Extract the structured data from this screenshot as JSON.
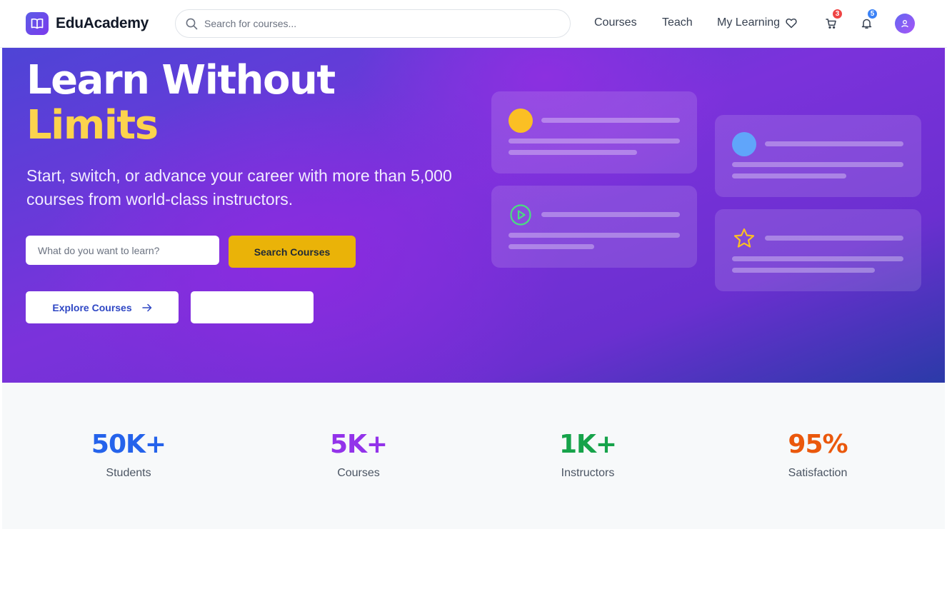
{
  "brand": {
    "name": "EduAcademy",
    "logo_icon": "book-open-icon"
  },
  "nav": {
    "search_placeholder": "Search for courses...",
    "links": {
      "courses": "Courses",
      "teach": "Teach",
      "my_learning": "My Learning"
    },
    "cart_count": "3",
    "notification_count": "5",
    "badge_colors": {
      "cart": "#ef4444",
      "notifications": "#3b82f6"
    }
  },
  "hero": {
    "title_line1": "Learn Without",
    "title_line2": "Limits",
    "subtitle": "Start, switch, or advance your career with more than 5,000 courses from world-class instructors.",
    "search_placeholder": "What do you want to learn?",
    "search_button": "Search Courses",
    "explore_button": "Explore Courses",
    "secondary_button": "",
    "colors": {
      "accent_yellow": "#fcd34d",
      "button_yellow": "#eab308",
      "gradient_start": "#4e44d6",
      "gradient_mid": "#7b32db",
      "gradient_end": "#2b3aa8"
    }
  },
  "illustration_cards": [
    {
      "icon": "yellow-circle",
      "color": "#fbbf24"
    },
    {
      "icon": "blue-circle",
      "color": "#60a5fa"
    },
    {
      "icon": "play-circle-icon",
      "color": "#4ade80"
    },
    {
      "icon": "star-icon",
      "color": "#fbbf24"
    }
  ],
  "stats": [
    {
      "value": "50K+",
      "label": "Students",
      "color": "#2563eb"
    },
    {
      "value": "5K+",
      "label": "Courses",
      "color": "#9333ea"
    },
    {
      "value": "1K+",
      "label": "Instructors",
      "color": "#16a34a"
    },
    {
      "value": "95%",
      "label": "Satisfaction",
      "color": "#ea580c"
    }
  ]
}
